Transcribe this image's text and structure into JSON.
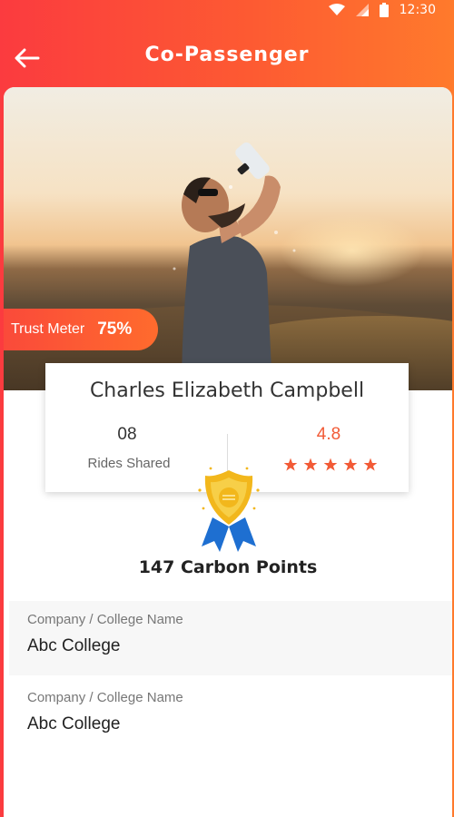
{
  "status_bar": {
    "time": "12:30",
    "icons": [
      "wifi-icon",
      "signal-icon",
      "battery-icon"
    ]
  },
  "app_bar": {
    "title": "Co-Passenger",
    "back_icon": "arrow-left-icon"
  },
  "hero": {
    "image": "man-drinking-water-photo"
  },
  "trust_meter": {
    "label": "Trust Meter",
    "value": "75%"
  },
  "profile": {
    "name": "Charles Elizabeth Campbell",
    "rides_count": "08",
    "rides_label": "Rides Shared",
    "rating": "4.8",
    "stars": 5
  },
  "badge": {
    "icon": "medal-icon"
  },
  "carbon_points": "147 Carbon Points",
  "fields": [
    {
      "label": "Company / College Name",
      "value": "Abc College"
    },
    {
      "label": "Company / College Name",
      "value": "Abc College"
    }
  ],
  "colors": {
    "accent": "#fb4a3c",
    "accent_end": "#ff7a2c",
    "rating": "#f25a36"
  }
}
